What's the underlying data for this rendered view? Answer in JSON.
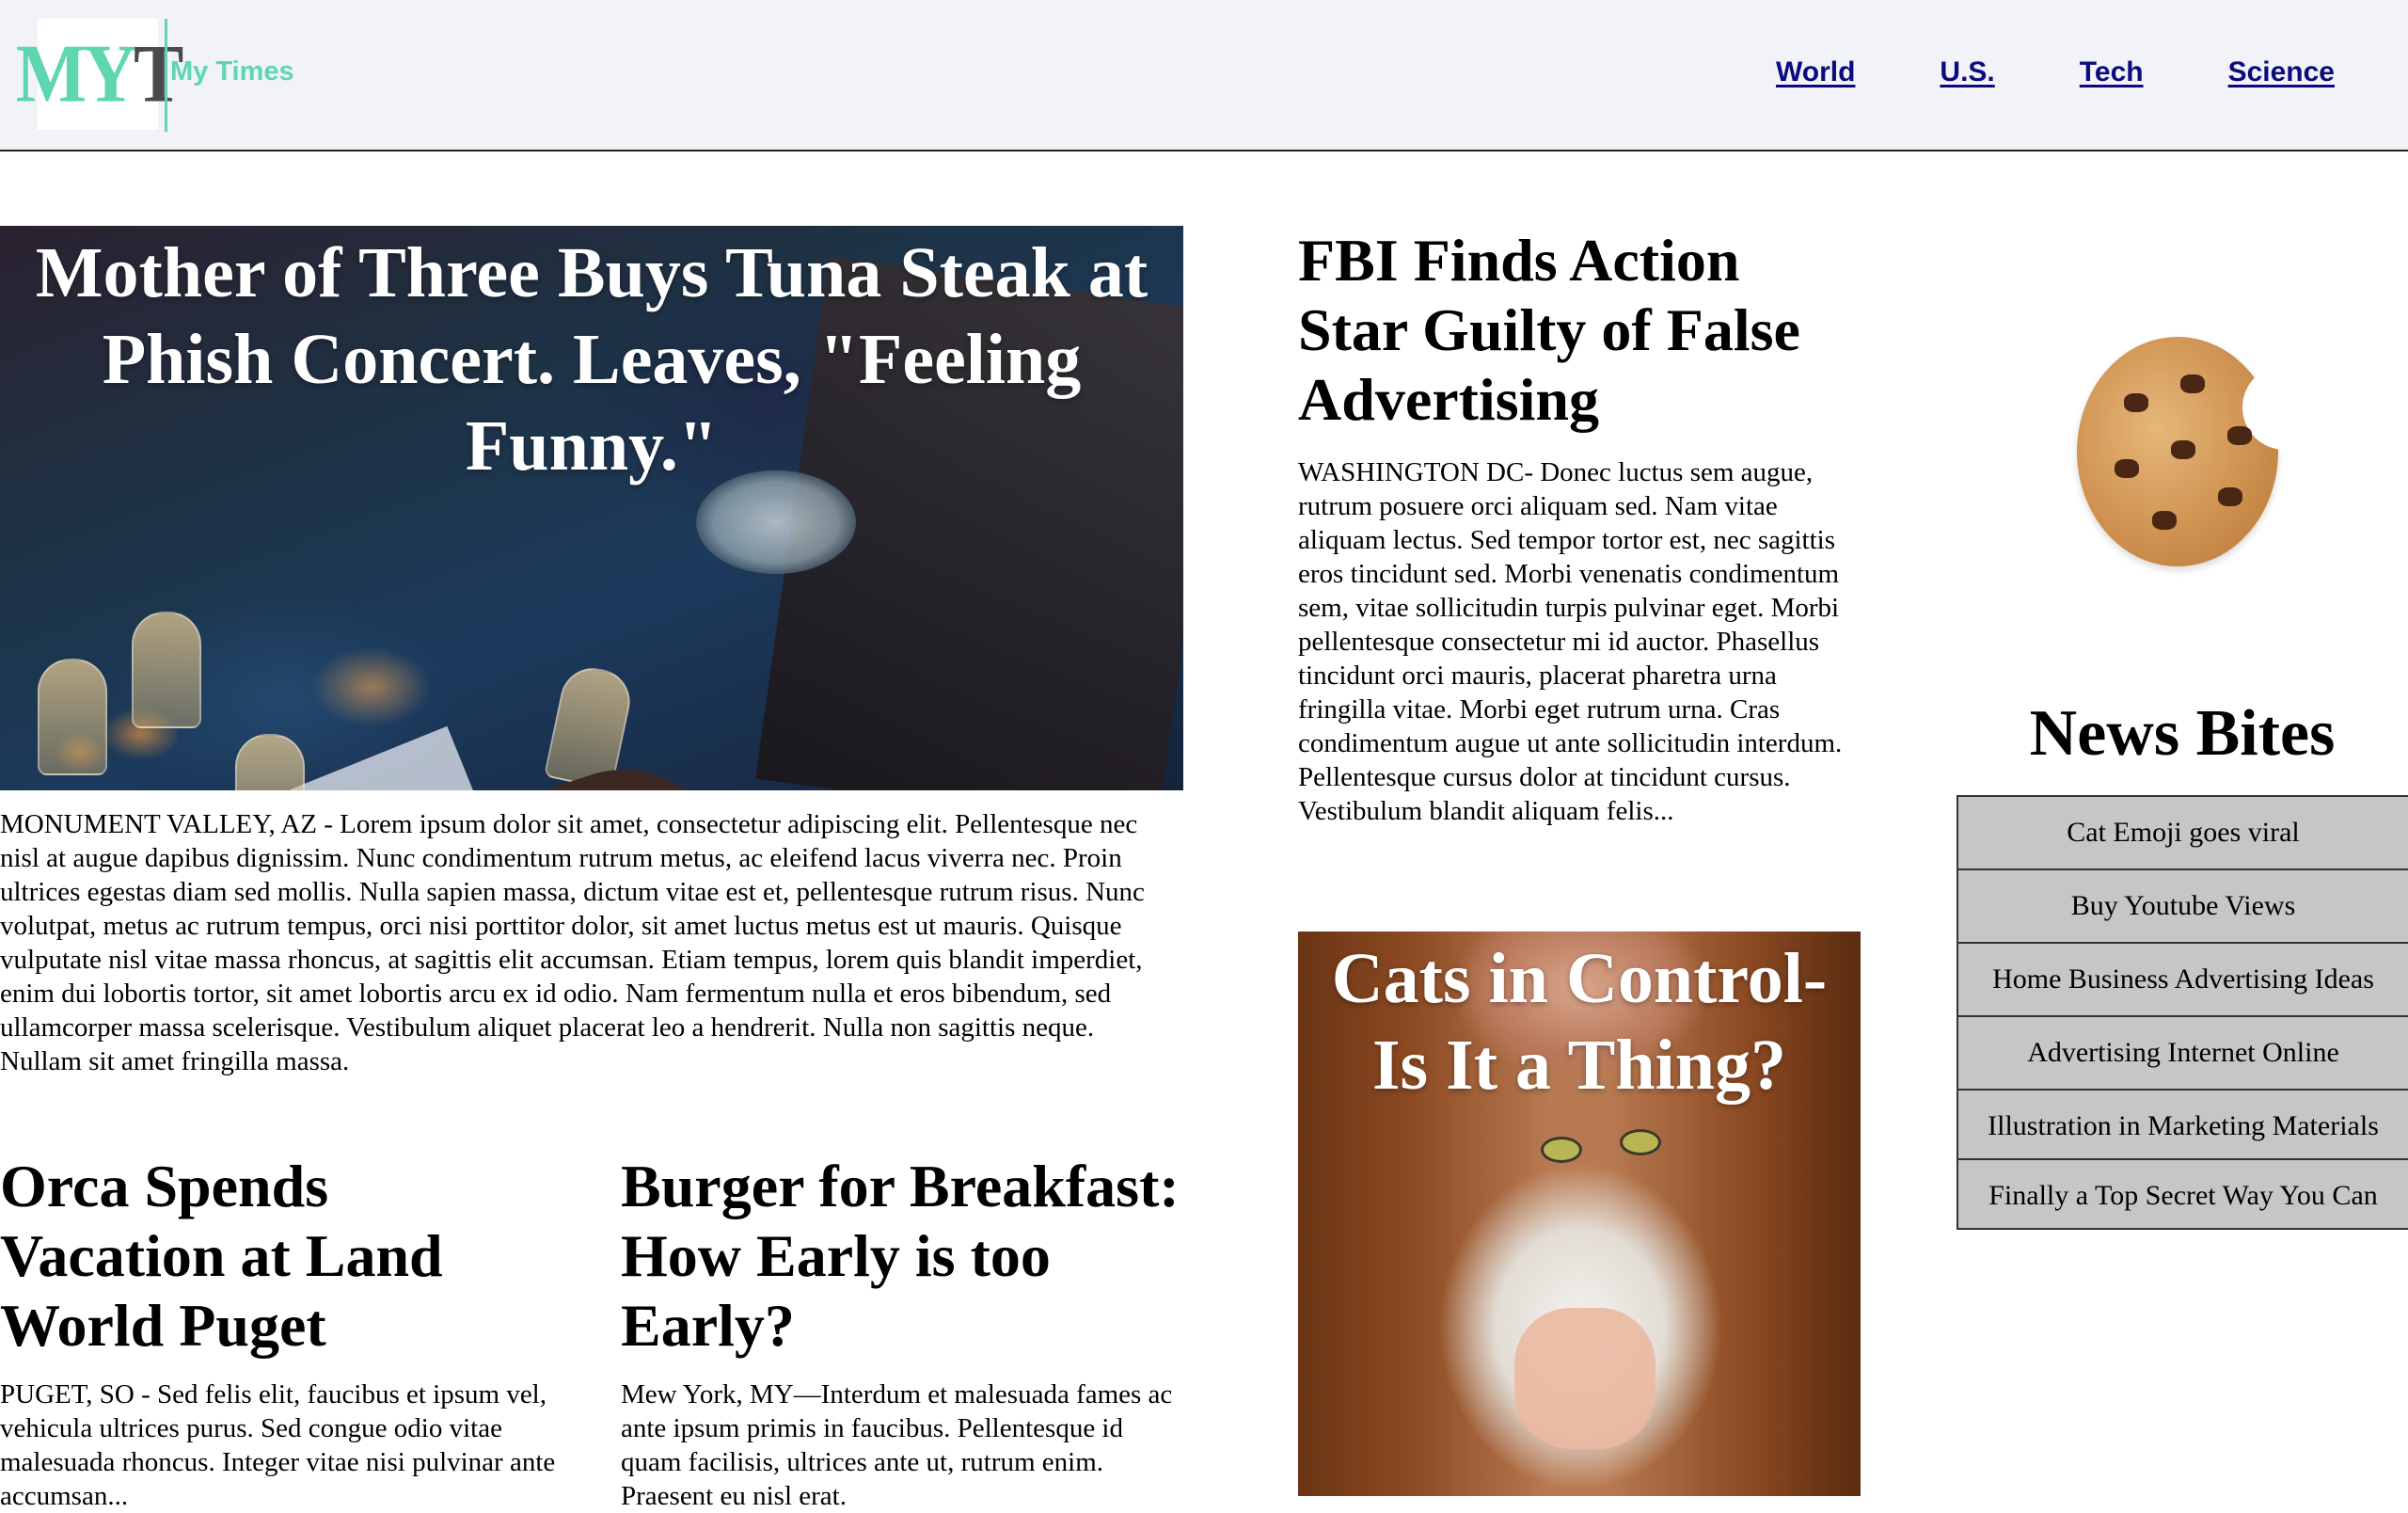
{
  "header": {
    "logo_text": "MYT",
    "brand_name": "My Times",
    "nav": [
      "World",
      "U.S.",
      "Tech",
      "Science"
    ],
    "colors": {
      "background": "#f2f3f9",
      "brand": "#5ed6b0",
      "nav_link": "#0b0b7d"
    }
  },
  "hero": {
    "title": "Mother of Three Buys Tuna Steak at Phish Concert. Leaves, \"Feeling Funny.\"",
    "body": "MONUMENT VALLEY, AZ - Lorem ipsum dolor sit amet, consectetur adipiscing elit. Pellentesque nec nisl at augue dapibus dignissim. Nunc condimentum rutrum metus, ac eleifend lacus viverra nec. Proin ultrices egestas diam sed mollis. Nulla sapien massa, dictum vitae est et, pellentesque rutrum risus. Nunc volutpat, metus ac rutrum tempus, orci nisi porttitor dolor, sit amet luctus metus est ut mauris. Quisque vulputate nisl vitae massa rhoncus, at sagittis elit accumsan. Etiam tempus, lorem quis blandit imperdiet, enim dui lobortis tortor, sit amet lobortis arcu ex id odio. Nam fermentum nulla et eros bibendum, sed ullamcorper massa scelerisque. Vestibulum aliquet placerat leo a hendrerit. Nulla non sagittis neque. Nullam sit amet fringilla massa."
  },
  "articles": {
    "orca": {
      "title": "Orca Spends Vacation at Land World Puget",
      "body": "PUGET, SO - Sed felis elit, faucibus et ipsum vel, vehicula ultrices purus. Sed congue odio vitae malesuada rhoncus. Integer vitae nisi pulvinar ante accumsan..."
    },
    "burger": {
      "title": "Burger for Breakfast: How Early is too Early?",
      "body": "Mew York, MY—Interdum et malesuada fames ac ante ipsum primis in faucibus. Pellentesque id quam facilisis, ultrices ante ut, rutrum enim. Praesent eu nisl erat."
    },
    "fbi": {
      "title": "FBI Finds Action Star Guilty of False Advertising",
      "body": "WASHINGTON DC- Donec luctus sem augue, rutrum posuere orci aliquam sed. Nam vitae aliquam lectus. Sed tempor tortor est, nec sagittis eros tincidunt sed. Morbi venenatis condimentum sem, vitae sollicitudin turpis pulvinar eget. Morbi pellentesque consectetur mi id auctor. Phasellus tincidunt orci mauris, placerat pharetra urna fringilla vitae. Morbi eget rutrum urna. Cras condimentum augue ut ante sollicitudin interdum. Pellentesque cursus dolor at tincidunt cursus. Vestibulum blandit aliquam felis..."
    },
    "cats": {
      "title": "Cats in Control- Is It a Thing?"
    }
  },
  "sidebar": {
    "title": "News Bites",
    "items": [
      "Cat Emoji goes viral",
      "Buy Youtube Views",
      "Home Business Advertising Ideas",
      "Advertising Internet Online",
      "Illustration in Marketing Materials",
      "Finally a Top Secret Way You Can"
    ]
  }
}
